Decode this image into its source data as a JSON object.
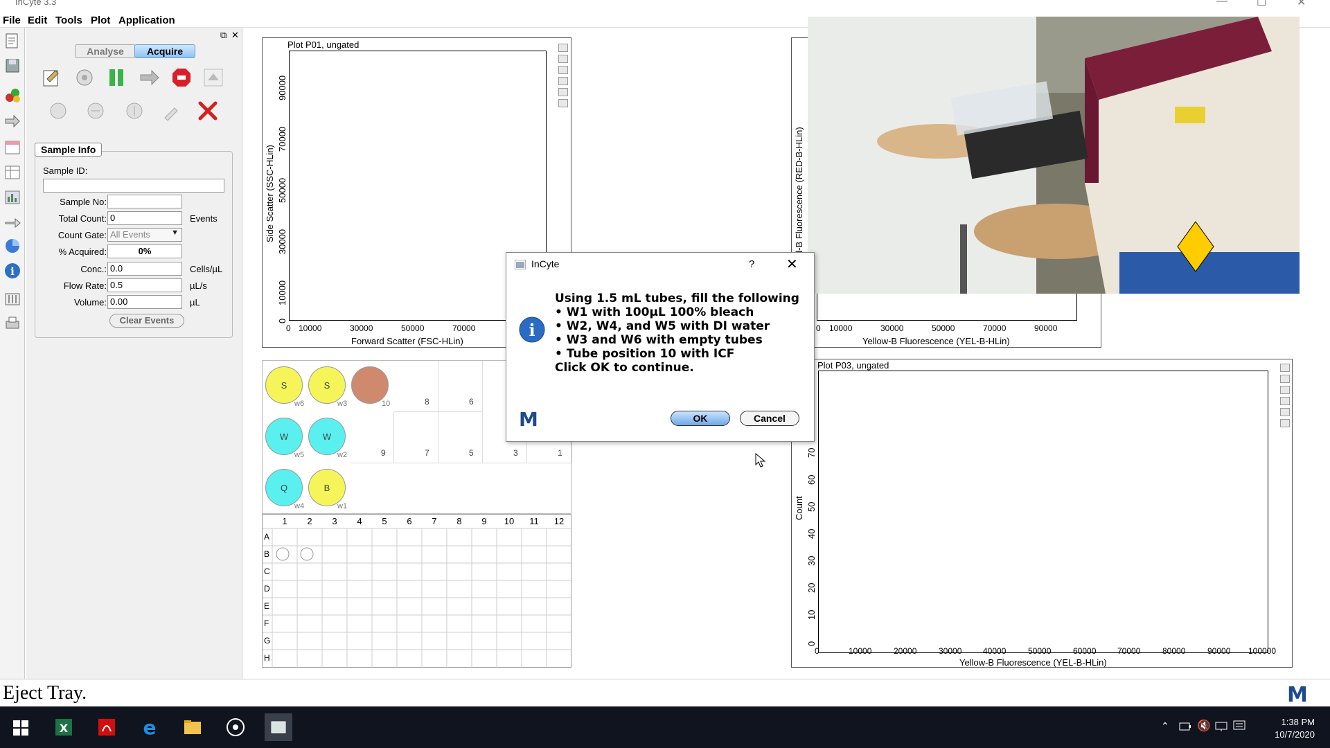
{
  "window": {
    "title": "InCyte 3.3"
  },
  "menu": [
    "File",
    "Edit",
    "Tools",
    "Plot",
    "Application"
  ],
  "panel": {
    "tabs": [
      "Analyse",
      "Acquire"
    ],
    "sample_info_title": "Sample Info",
    "sample_id_label": "Sample ID:",
    "sample_id_value": "",
    "fields": [
      {
        "label": "Sample No:",
        "value": "",
        "unit": ""
      },
      {
        "label": "Total Count:",
        "value": "0",
        "unit": "Events"
      },
      {
        "label": "Count Gate:",
        "value": "All Events",
        "unit": ""
      },
      {
        "label": "% Acquired:",
        "value": "0%",
        "unit": ""
      },
      {
        "label": "Conc.:",
        "value": "0.0",
        "unit": "Cells/µL"
      },
      {
        "label": "Flow Rate:",
        "value": "0.5",
        "unit": "µL/s"
      },
      {
        "label": "Volume:",
        "value": "0.00",
        "unit": "µL"
      }
    ],
    "clear_events": "Clear Events"
  },
  "plots": {
    "p01": {
      "title": "Plot P01, ungated",
      "xlabel": "Forward Scatter (FSC-HLin)",
      "ylabel": "Side Scatter (SSC-HLin)",
      "xticks": [
        "0",
        "10000",
        "30000",
        "50000",
        "70000"
      ],
      "yticks": [
        "0",
        "10000",
        "30000",
        "50000",
        "70000",
        "90000"
      ]
    },
    "p02": {
      "ylabel": "d-B Fluorescence (RED-B-HLin)",
      "xlabel": "Yellow-B Fluorescence (YEL-B-HLin)",
      "xticks": [
        "0",
        "10000",
        "30000",
        "50000",
        "70000",
        "90000"
      ]
    },
    "p03": {
      "title": "Plot P03, ungated",
      "xlabel": "Yellow-B Fluorescence (YEL-B-HLin)",
      "ylabel": "Count",
      "xticks": [
        "0",
        "10000",
        "20000",
        "30000",
        "40000",
        "50000",
        "60000",
        "70000",
        "80000",
        "90000",
        "100000"
      ],
      "yticks": [
        "0",
        "10",
        "20",
        "30",
        "40",
        "50",
        "60",
        "70"
      ]
    }
  },
  "rack": {
    "tubes": [
      {
        "label": "S",
        "id": "w6",
        "color": "#f5f55a"
      },
      {
        "label": "S",
        "id": "w3",
        "color": "#f5f55a"
      },
      {
        "label": "",
        "id": "10",
        "color": "#cf8a6e"
      },
      {
        "label": "W",
        "id": "w5",
        "color": "#5af0f0"
      },
      {
        "label": "W",
        "id": "w2",
        "color": "#5af0f0"
      },
      {
        "label": "Q",
        "id": "w4",
        "color": "#5af0f0"
      },
      {
        "label": "B",
        "id": "w1",
        "color": "#f5f55a"
      }
    ],
    "slots_top": [
      "8",
      "6"
    ],
    "slots_mid": [
      "9",
      "7",
      "5",
      "3",
      "1"
    ]
  },
  "plate": {
    "cols": [
      "1",
      "2",
      "3",
      "4",
      "5",
      "6",
      "7",
      "8",
      "9",
      "10",
      "11",
      "12"
    ],
    "rows": [
      "A",
      "B",
      "C",
      "D",
      "E",
      "F",
      "G",
      "H"
    ]
  },
  "dialog": {
    "title": "InCyte",
    "help": "?",
    "lines": [
      "Using 1.5 mL tubes, fill the following",
      "• W1 with 100µL 100% bleach",
      "• W2, W4, and W5 with DI water",
      "• W3 and W6 with empty tubes",
      "• Tube position 10 with ICF",
      "Click OK to continue."
    ],
    "ok": "OK",
    "cancel": "Cancel"
  },
  "status": {
    "text": "Eject Tray."
  },
  "clock": {
    "time": "1:38 PM",
    "date": "10/7/2020"
  },
  "colors": {
    "accent": "#1f6fc6",
    "brand_m": "#1d4a8c"
  }
}
